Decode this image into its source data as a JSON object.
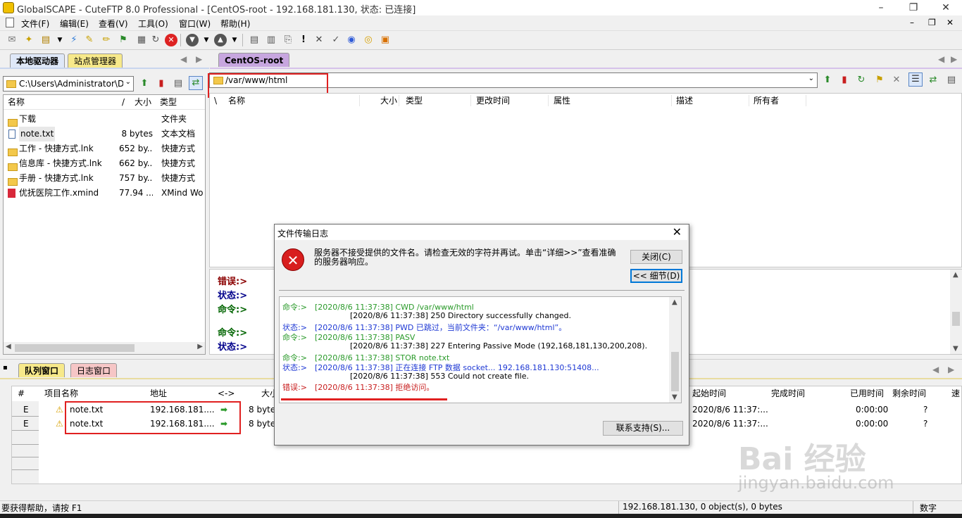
{
  "window": {
    "title": "GlobalSCAPE - CuteFTP 8.0 Professional - [CentOS-root - 192.168.181.130, 状态: 已连接]"
  },
  "menu": [
    "文件(F)",
    "编辑(E)",
    "查看(V)",
    "工具(O)",
    "窗口(W)",
    "帮助(H)"
  ],
  "left_pane": {
    "tabs": [
      "本地驱动器",
      "站点管理器"
    ],
    "path": "C:\\Users\\Administrator\\D",
    "columns": [
      "名称",
      "/",
      "大小",
      "类型"
    ],
    "files": [
      {
        "name": "下载",
        "size": "",
        "type": "文件夹",
        "icon": "folder-icon"
      },
      {
        "name": "note.txt",
        "size": "8 bytes",
        "type": "文本文档",
        "icon": "text-file-icon"
      },
      {
        "name": "工作 - 快捷方式.lnk",
        "size": "652 by...",
        "type": "快捷方式",
        "icon": "shortcut-icon"
      },
      {
        "name": "信息库 - 快捷方式.lnk",
        "size": "662 by...",
        "type": "快捷方式",
        "icon": "shortcut-icon"
      },
      {
        "name": "手册 - 快捷方式.lnk",
        "size": "757 by...",
        "type": "快捷方式",
        "icon": "shortcut-icon"
      },
      {
        "name": "优抚医院工作.xmind",
        "size": "77.94 ...",
        "type": "XMind Wo",
        "icon": "xmind-icon"
      }
    ]
  },
  "right_pane": {
    "tab": "CentOS-root",
    "path": "/var/www/html",
    "columns": [
      "\\",
      "名称",
      "大小",
      "类型",
      "更改时间",
      "属性",
      "描述",
      "所有者"
    ]
  },
  "session_log": [
    {
      "label": "错误:>",
      "color": "#8b0000"
    },
    {
      "label": "状态:>",
      "color": "#00008b"
    },
    {
      "label": "命令:>",
      "color": "#006400"
    },
    {
      "label": "命令:>",
      "color": "#006400"
    },
    {
      "label": "状态:>",
      "color": "#00008b"
    }
  ],
  "bottom": {
    "tabs": [
      "队列窗口",
      "日志窗口"
    ],
    "columns": [
      "#",
      "项目名称",
      "地址",
      "<->",
      "大小",
      "起始时间",
      "完成时间",
      "已用时间",
      "剩余时间",
      "速"
    ],
    "rows": [
      {
        "num": "E",
        "name": "note.txt",
        "address": "192.168.181....",
        "size": "8 byte",
        "start": "2020/8/6 11:37:...",
        "elapsed": "0:00:00",
        "remaining": "?"
      },
      {
        "num": "E",
        "name": "note.txt",
        "address": "192.168.181....",
        "size": "8 byte",
        "start": "2020/8/6 11:37:...",
        "elapsed": "0:00:00",
        "remaining": "?"
      }
    ]
  },
  "dialog": {
    "title": "文件传输日志",
    "message_line1": "服务器不接受提供的文件名。请检查无效的字符并再试。单击“详细>>”查看准确",
    "message_line2": "的服务器响应。",
    "close_label": "关闭(C)",
    "details_label": "<< 细节(D)",
    "support_label": "联系支持(S)...",
    "log": [
      {
        "prefix": "命令:>",
        "time": "[2020/8/6 11:37:38]",
        "text": "CWD /var/www/html",
        "cls": "c-cmd"
      },
      {
        "prefix": "",
        "time": "[2020/8/6 11:37:38]",
        "text": "250 Directory successfully changed.",
        "cls": "c-resp"
      },
      {
        "prefix": "状态:>",
        "time": "[2020/8/6 11:37:38]",
        "text": "PWD 已跳过，当前文件夹：“/var/www/html”。",
        "cls": "c-st"
      },
      {
        "prefix": "命令:>",
        "time": "[2020/8/6 11:37:38]",
        "text": "PASV",
        "cls": "c-cmd"
      },
      {
        "prefix": "",
        "time": "[2020/8/6 11:37:38]",
        "text": "227 Entering Passive Mode (192,168,181,130,200,208).",
        "cls": "c-resp"
      },
      {
        "prefix": "命令:>",
        "time": "[2020/8/6 11:37:38]",
        "text": "STOR note.txt",
        "cls": "c-cmd"
      },
      {
        "prefix": "状态:>",
        "time": "[2020/8/6 11:37:38]",
        "text": "正在连接 FTP 数据 socket... 192.168.181.130:51408...",
        "cls": "c-st"
      },
      {
        "prefix": "",
        "time": "[2020/8/6 11:37:38]",
        "text": "553 Could not create file.",
        "cls": "c-resp"
      },
      {
        "prefix": "错误:>",
        "time": "[2020/8/6 11:37:38]",
        "text": "拒绝访问。",
        "cls": "c-err"
      }
    ]
  },
  "statusbar": {
    "help": "要获得帮助，请按 F1",
    "connection": "192.168.181.130, 0 object(s), 0 bytes",
    "numlock": "数字"
  },
  "watermark": {
    "text": "Bai 经验",
    "subtext": "jingyan.baidu.com"
  }
}
